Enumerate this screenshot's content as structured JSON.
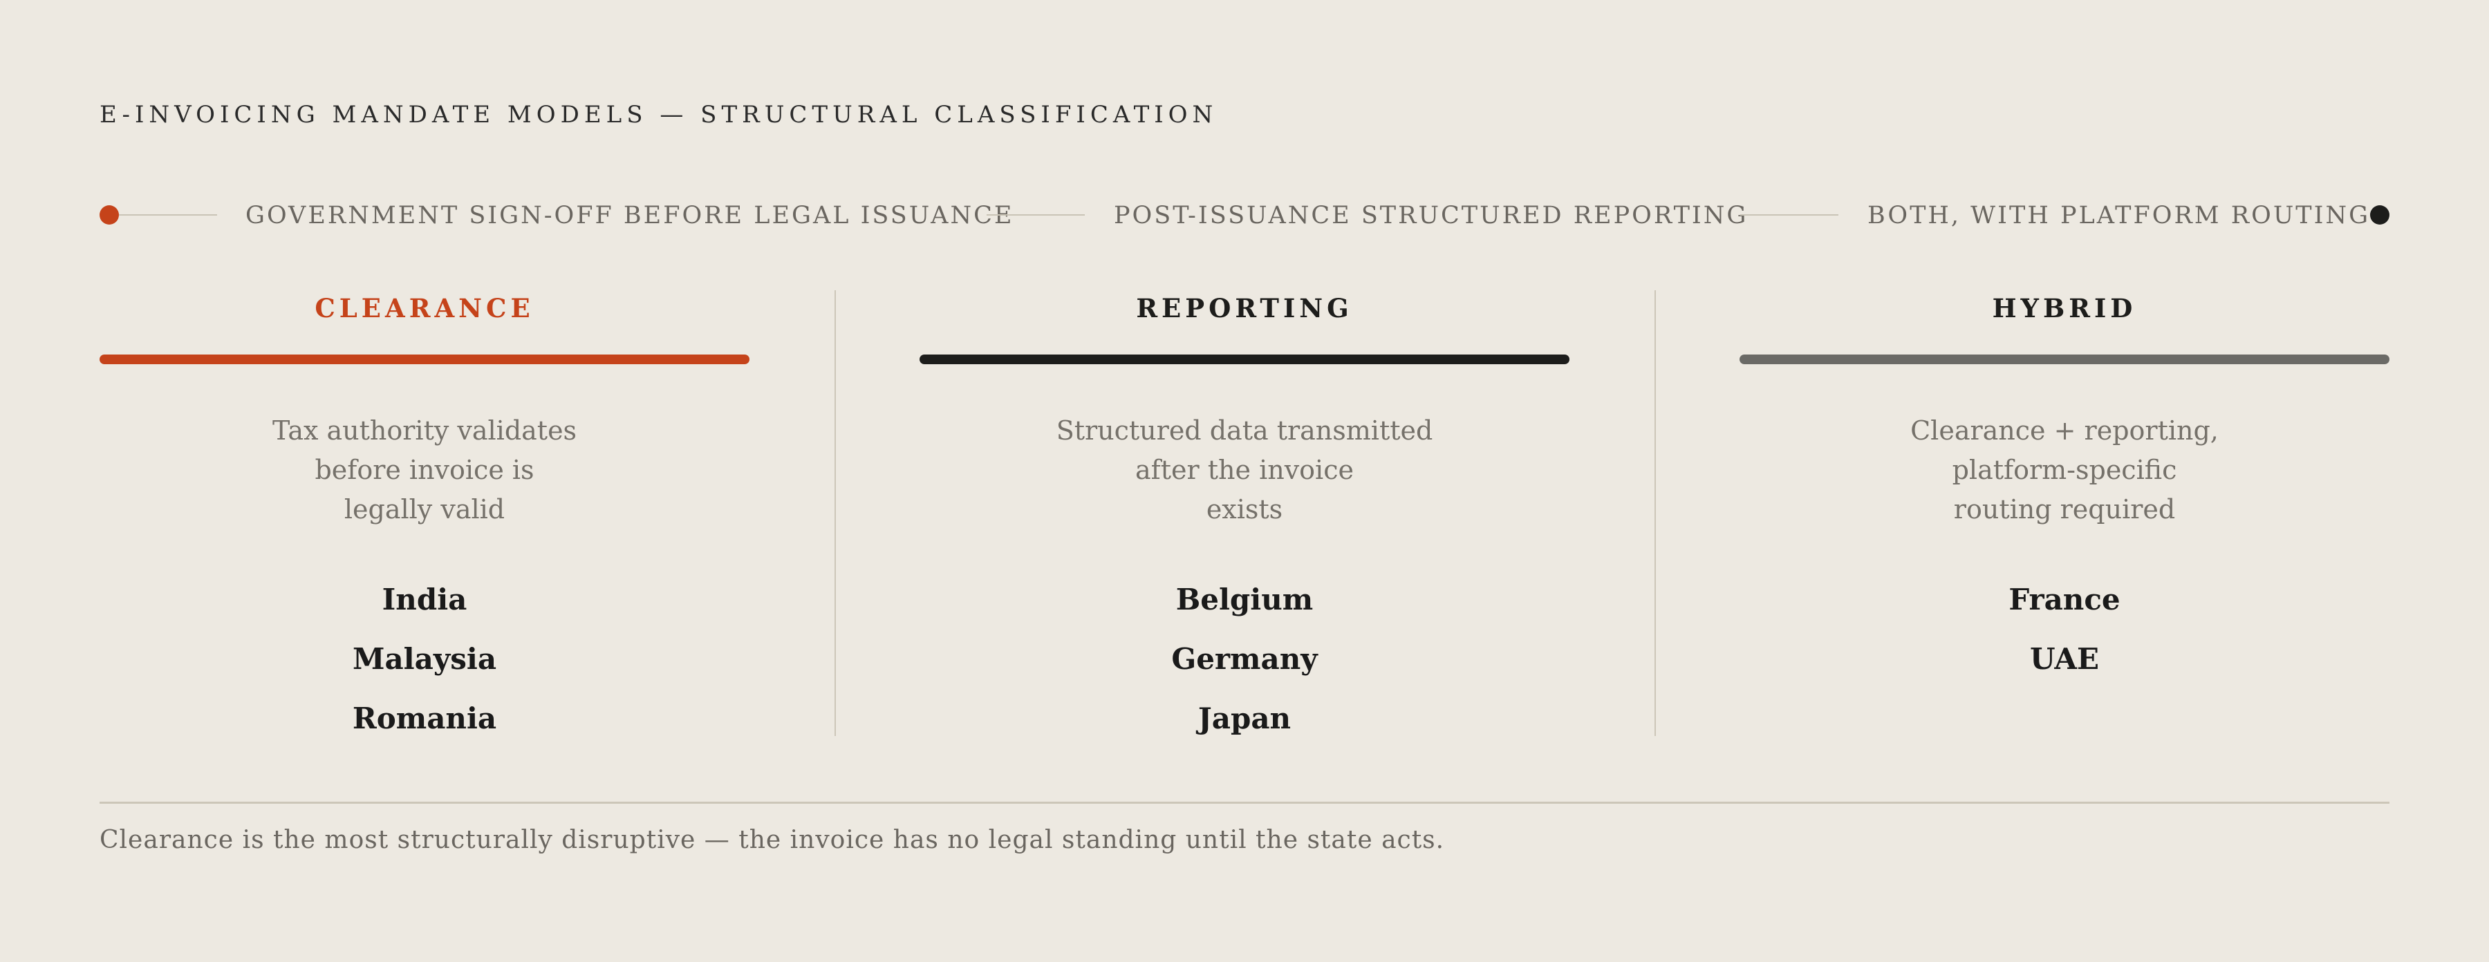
{
  "title": "E-INVOICING MANDATE MODELS — STRUCTURAL CLASSIFICATION",
  "colors": {
    "clearance": "#C5431A",
    "reporting": "#1D1D1B",
    "hybrid": "#6B6A66",
    "background": "#EDE9E1"
  },
  "legend": {
    "start_label": "GOVERNMENT SIGN-OFF BEFORE LEGAL ISSUANCE",
    "middle_label": "POST-ISSUANCE STRUCTURED REPORTING",
    "end_label": "BOTH, WITH PLATFORM ROUTING"
  },
  "columns": [
    {
      "title": "CLEARANCE",
      "description": [
        "Tax authority validates",
        "before invoice is",
        "legally valid"
      ],
      "countries": [
        "India",
        "Malaysia",
        "Romania"
      ]
    },
    {
      "title": "REPORTING",
      "description": [
        "Structured data transmitted",
        "after the invoice",
        "exists"
      ],
      "countries": [
        "Belgium",
        "Germany",
        "Japan"
      ]
    },
    {
      "title": "HYBRID",
      "description": [
        "Clearance + reporting,",
        "platform-specific",
        "routing required"
      ],
      "countries": [
        "France",
        "UAE"
      ]
    }
  ],
  "footer_note": "Clearance is the most structurally disruptive — the invoice has no legal standing until the state acts."
}
